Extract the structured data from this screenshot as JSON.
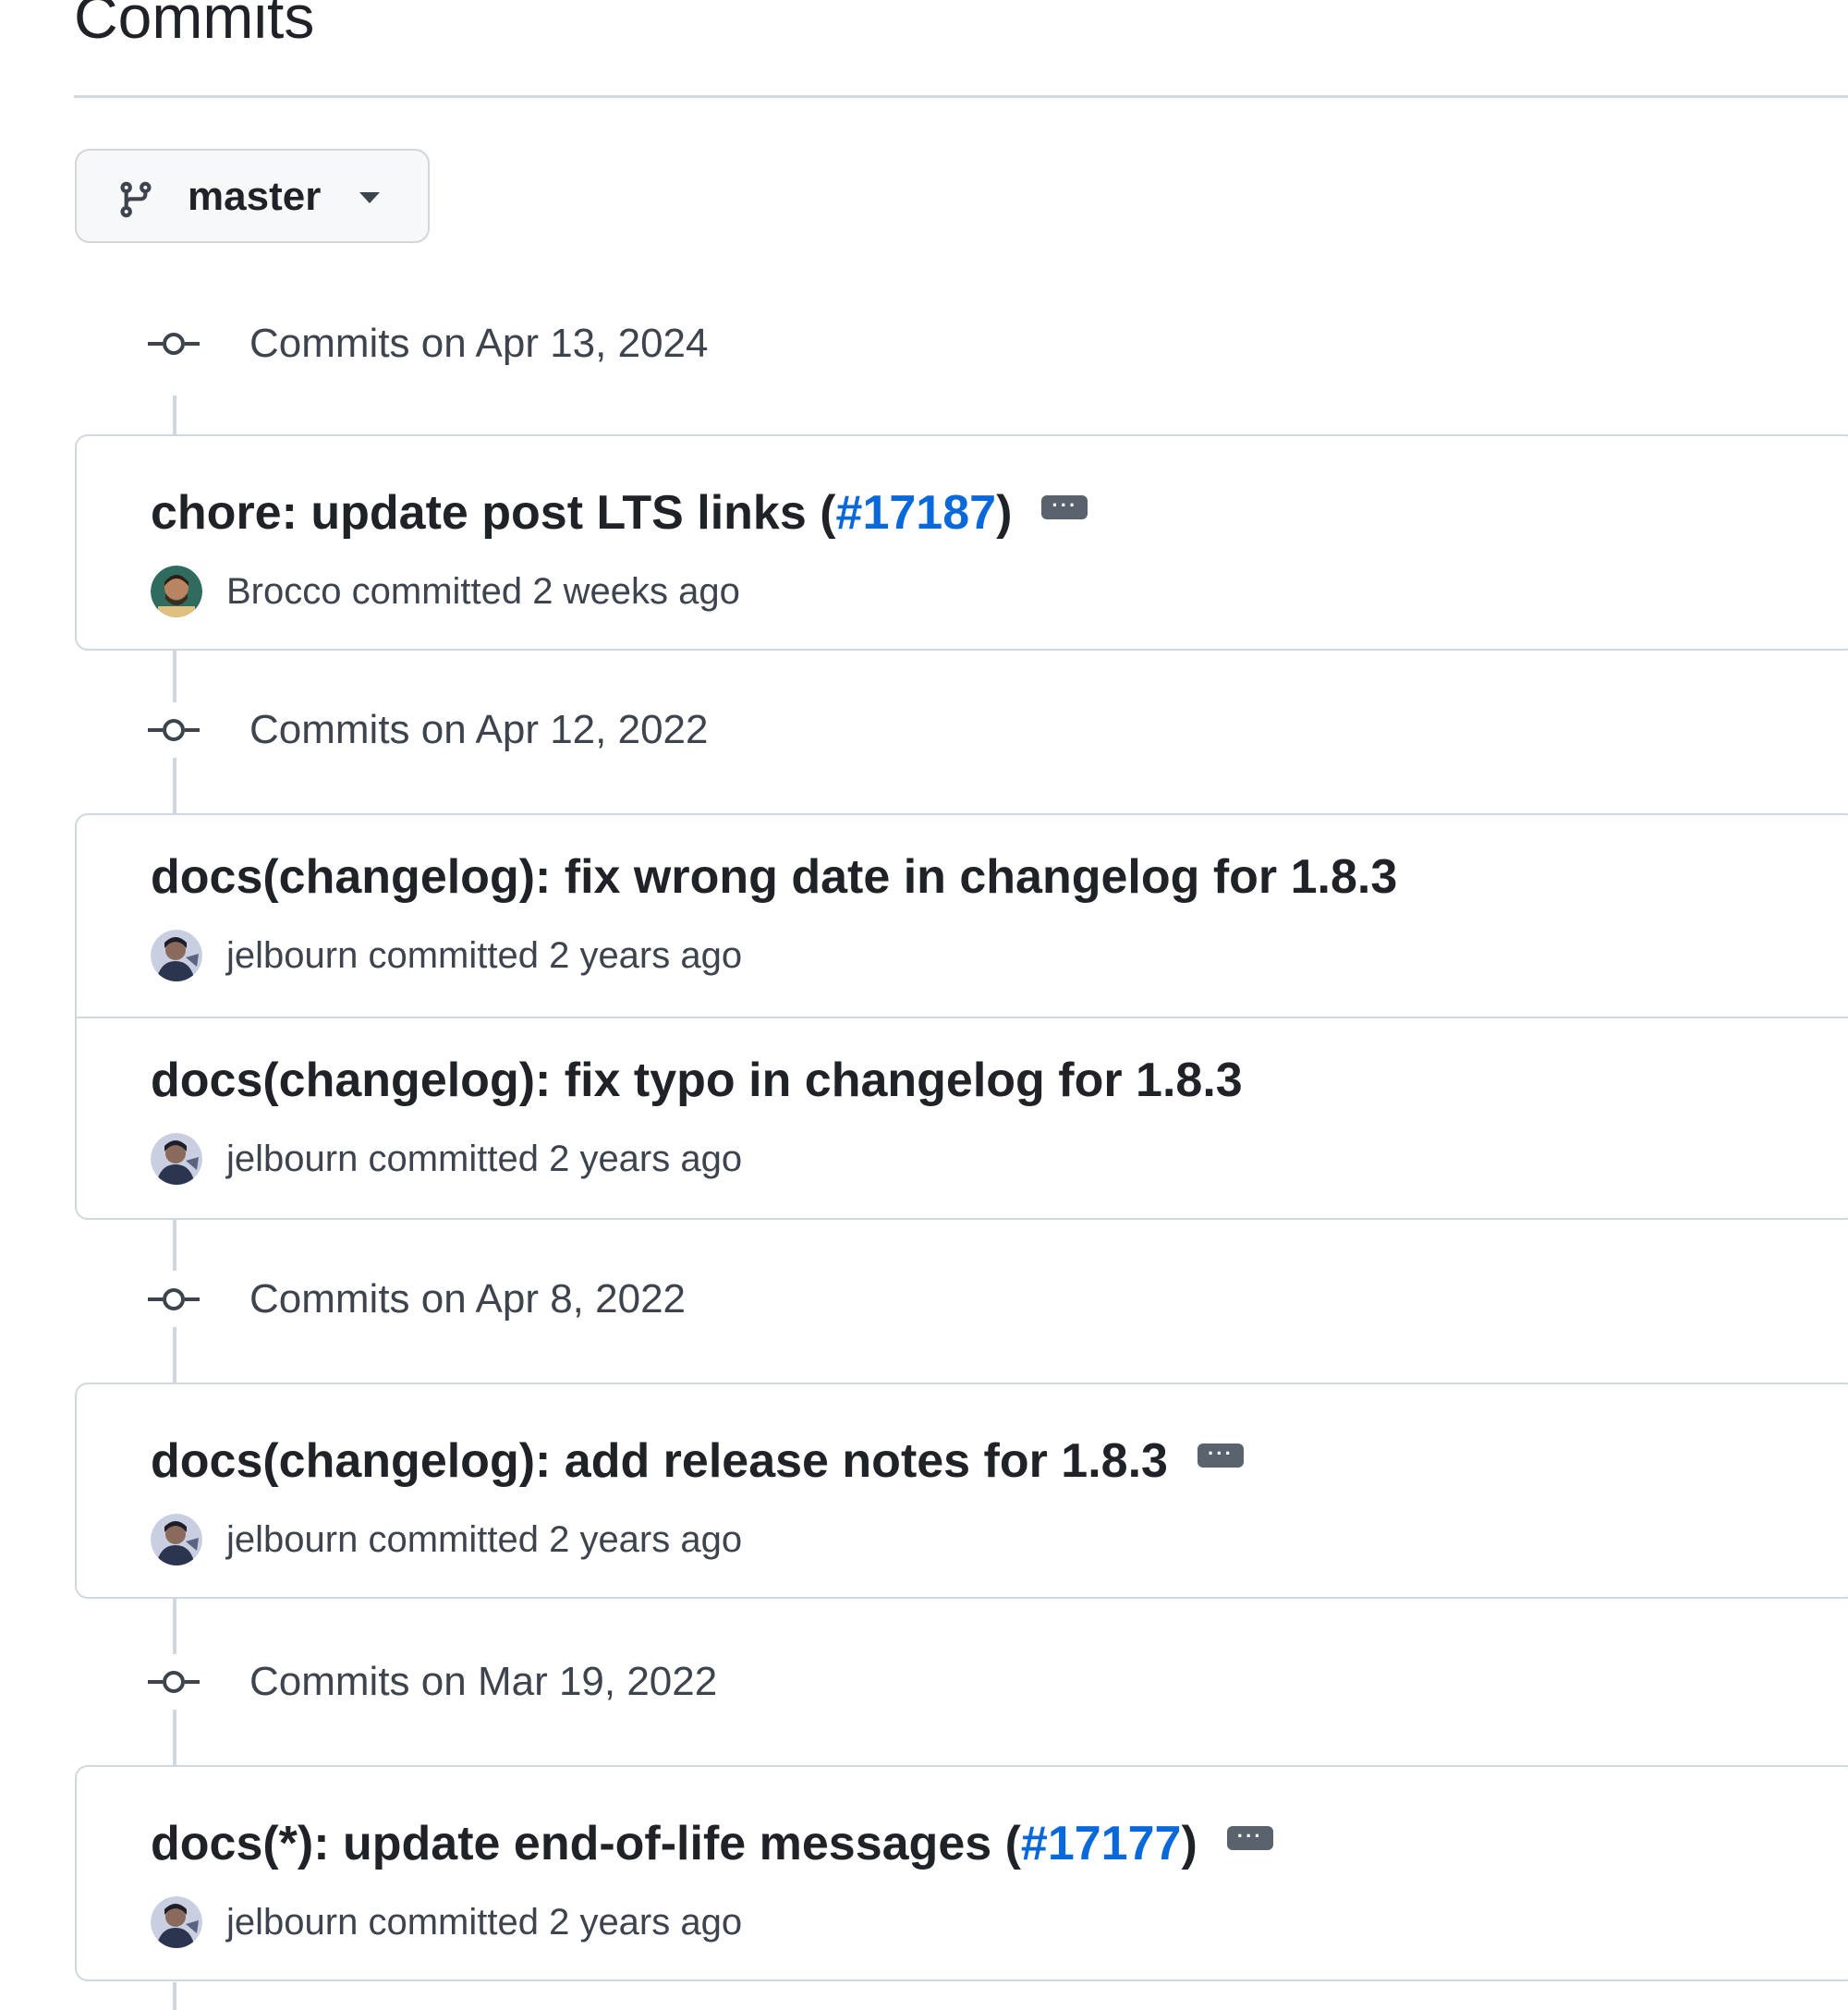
{
  "page": {
    "title": "Commits"
  },
  "branch": {
    "name": "master",
    "icon": "git-branch-icon",
    "caret_icon": "triangle-down-icon"
  },
  "colors": {
    "link": "#0969da",
    "border": "#d0d7de",
    "muted_text": "#3d444d",
    "ellipsis_bg": "#59636e"
  },
  "groups": [
    {
      "date_label": "Commits on Apr 13, 2024",
      "commits": [
        {
          "title": "chore: update post LTS links (",
          "pr": "#17187",
          "title_end": ")",
          "has_ellipsis": true,
          "author": "Brocco",
          "action": "committed",
          "time": "2 weeks ago"
        }
      ]
    },
    {
      "date_label": "Commits on Apr 12, 2022",
      "commits": [
        {
          "title": "docs(changelog): fix wrong date in changelog for 1.8.3",
          "pr": "",
          "title_end": "",
          "has_ellipsis": false,
          "author": "jelbourn",
          "action": "committed",
          "time": "2 years ago"
        },
        {
          "title": "docs(changelog): fix typo in changelog for 1.8.3",
          "pr": "",
          "title_end": "",
          "has_ellipsis": false,
          "author": "jelbourn",
          "action": "committed",
          "time": "2 years ago"
        }
      ]
    },
    {
      "date_label": "Commits on Apr 8, 2022",
      "commits": [
        {
          "title": "docs(changelog): add release notes for 1.8.3",
          "pr": "",
          "title_end": "",
          "has_ellipsis": true,
          "author": "jelbourn",
          "action": "committed",
          "time": "2 years ago"
        }
      ]
    },
    {
      "date_label": "Commits on Mar 19, 2022",
      "commits": [
        {
          "title": "docs(*): update end-of-life messages (",
          "pr": "#17177",
          "title_end": ")",
          "has_ellipsis": true,
          "author": "jelbourn",
          "action": "committed",
          "time": "2 years ago"
        }
      ]
    }
  ]
}
